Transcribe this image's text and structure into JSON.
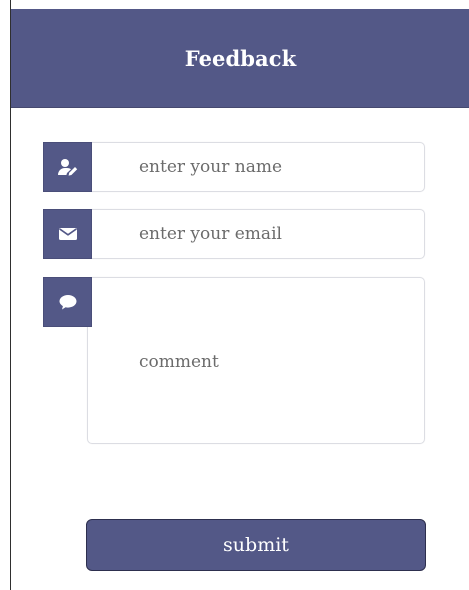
{
  "header": {
    "title": "Feedback"
  },
  "form": {
    "name": {
      "placeholder": "enter your name",
      "icon": "user-edit-icon"
    },
    "email": {
      "placeholder": "enter your email",
      "icon": "envelope-icon"
    },
    "comment": {
      "placeholder": "comment",
      "icon": "chat-bubble-icon"
    },
    "submit_label": "submit"
  },
  "colors": {
    "header_bg": "#535887",
    "icon_bg": "#535887",
    "button_bg": "#535887",
    "text_muted": "#6b6b6b",
    "field_border": "#dcdde3"
  }
}
